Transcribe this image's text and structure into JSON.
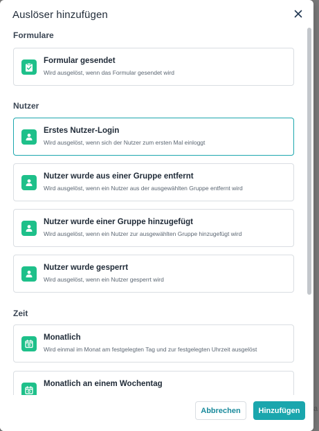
{
  "modal": {
    "title": "Auslöser hinzufügen",
    "close_icon": "close-icon"
  },
  "sections": [
    {
      "heading": "Formulare",
      "items": [
        {
          "title": "Formular gesendet",
          "description": "Wird ausgelöst, wenn das Formular gesendet wird",
          "icon": "form-check-icon",
          "selected": false
        }
      ]
    },
    {
      "heading": "Nutzer",
      "items": [
        {
          "title": "Erstes Nutzer-Login",
          "description": "Wird ausgelöst, wenn sich der Nutzer zum ersten Mal einloggt",
          "icon": "user-icon",
          "selected": true
        },
        {
          "title": "Nutzer wurde aus einer Gruppe entfernt",
          "description": "Wird ausgelöst, wenn ein Nutzer aus der ausgewählten Gruppe entfernt wird",
          "icon": "user-icon",
          "selected": false
        },
        {
          "title": "Nutzer wurde einer Gruppe hinzugefügt",
          "description": "Wird ausgelöst, wenn ein Nutzer zur ausgewählten Gruppe hinzugefügt wird",
          "icon": "user-icon",
          "selected": false
        },
        {
          "title": "Nutzer wurde gesperrt",
          "description": "Wird ausgelöst, wenn ein Nutzer gesperrt wird",
          "icon": "user-icon",
          "selected": false
        }
      ]
    },
    {
      "heading": "Zeit",
      "items": [
        {
          "title": "Monatlich",
          "description": "Wird einmal im Monat am festgelegten Tag und zur festgelegten Uhrzeit ausgelöst",
          "icon": "calendar-icon",
          "selected": false
        },
        {
          "title": "Monatlich an einem Wochentag",
          "description": "",
          "icon": "calendar-icon",
          "selected": false
        }
      ]
    }
  ],
  "footer": {
    "cancel_label": "Abbrechen",
    "add_label": "Hinzufügen"
  },
  "colors": {
    "accent": "#1aa6ad",
    "icon_bg": "#1ec08a",
    "border": "#d9dde2"
  }
}
